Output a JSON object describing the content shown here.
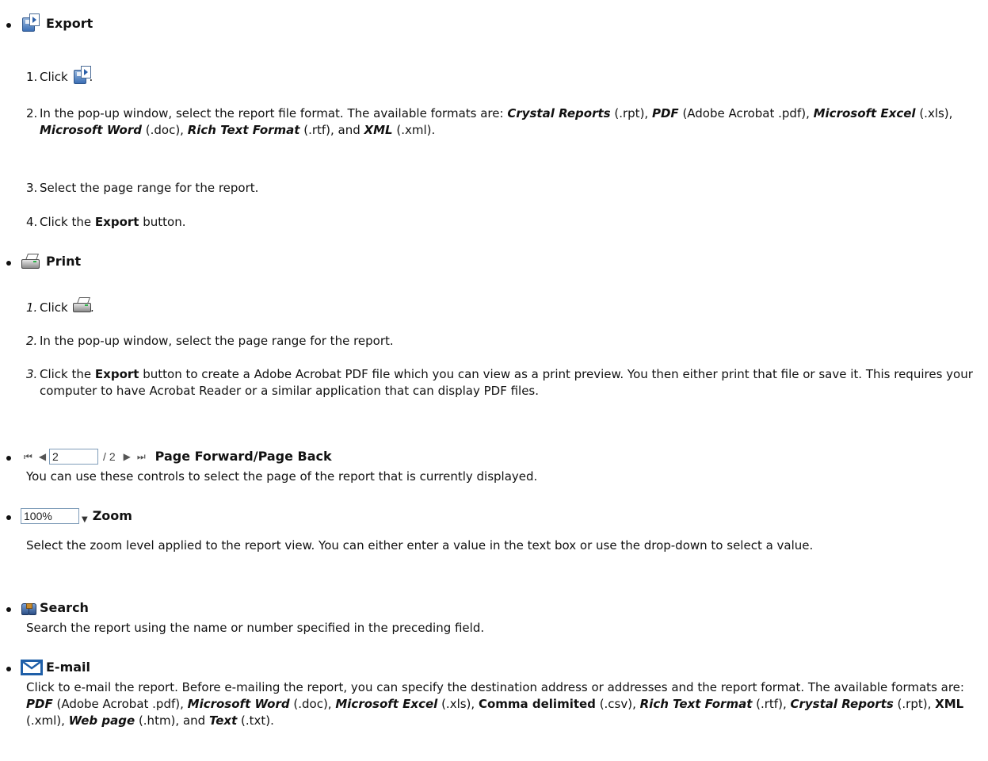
{
  "export": {
    "heading": "Export",
    "steps": [
      {
        "num": "1.",
        "prefix": "Click ",
        "suffix": "."
      },
      {
        "num": "2.",
        "text_a": "In the pop-up window, select the report file format. The available formats are: ",
        "f1": "Crystal Reports",
        "e1": " (.rpt), ",
        "f2": "PDF",
        "e2": " (Adobe Acrobat .pdf), ",
        "f3": "Microsoft Excel",
        "e3": " (.xls), ",
        "f4": "Microsoft Word",
        "e4": " (.doc), ",
        "f5": "Rich Text Format",
        "e5": " (.rtf), and ",
        "f6": "XML",
        "e6": " (.xml)."
      },
      {
        "num": "3.",
        "text": "Select the page range for the report."
      },
      {
        "num": "4.",
        "prefix": "Click the ",
        "bold": "Export",
        "suffix": " button."
      }
    ]
  },
  "print": {
    "heading": "Print",
    "steps": [
      {
        "num": "1.",
        "prefix": "Click ",
        "suffix": "."
      },
      {
        "num": "2.",
        "text": "In the pop-up window, select the page range for the report."
      },
      {
        "num": "3.",
        "prefix": "Click the ",
        "bold": "Export",
        "suffix": " button to create a Adobe Acrobat PDF file which you can view as a print preview. You then either print that file or save it. This requires your computer to have Acrobat Reader or a similar application that can display PDF files."
      }
    ]
  },
  "paging": {
    "page_value": "2",
    "total": "/ 2",
    "heading": "Page Forward/Page Back",
    "description": "You can use these controls to select the page of the report that is currently displayed."
  },
  "zoom": {
    "value": "100%",
    "heading": "Zoom",
    "description": "Select the zoom level applied to the report view. You can either enter a value in the text box or use the drop-down to select a value."
  },
  "search": {
    "heading": "Search",
    "description": "Search the report using the name or number specified in the preceding field."
  },
  "email": {
    "heading": "E-mail",
    "d1": "Click to e-mail the report. Before e-mailing the report, you can specify the destination address or addresses and the report format. The available formats are: ",
    "f1": "PDF",
    "e1": " (Adobe Acrobat .pdf), ",
    "f2": "Microsoft Word",
    "e2": " (.doc), ",
    "f3": "Microsoft Excel",
    "e3": " (.xls), ",
    "f4": "Comma delimited",
    "e4": " (.csv), ",
    "f5": "Rich Text Format",
    "e5": " (.rtf), ",
    "f6": "Crystal Reports",
    "e6": " (.rpt), ",
    "f7": "XML",
    "e7": " (.xml),  ",
    "f8": "Web page",
    "e8": " (.htm), and ",
    "f9": "Text",
    "e9": " (.txt)."
  }
}
